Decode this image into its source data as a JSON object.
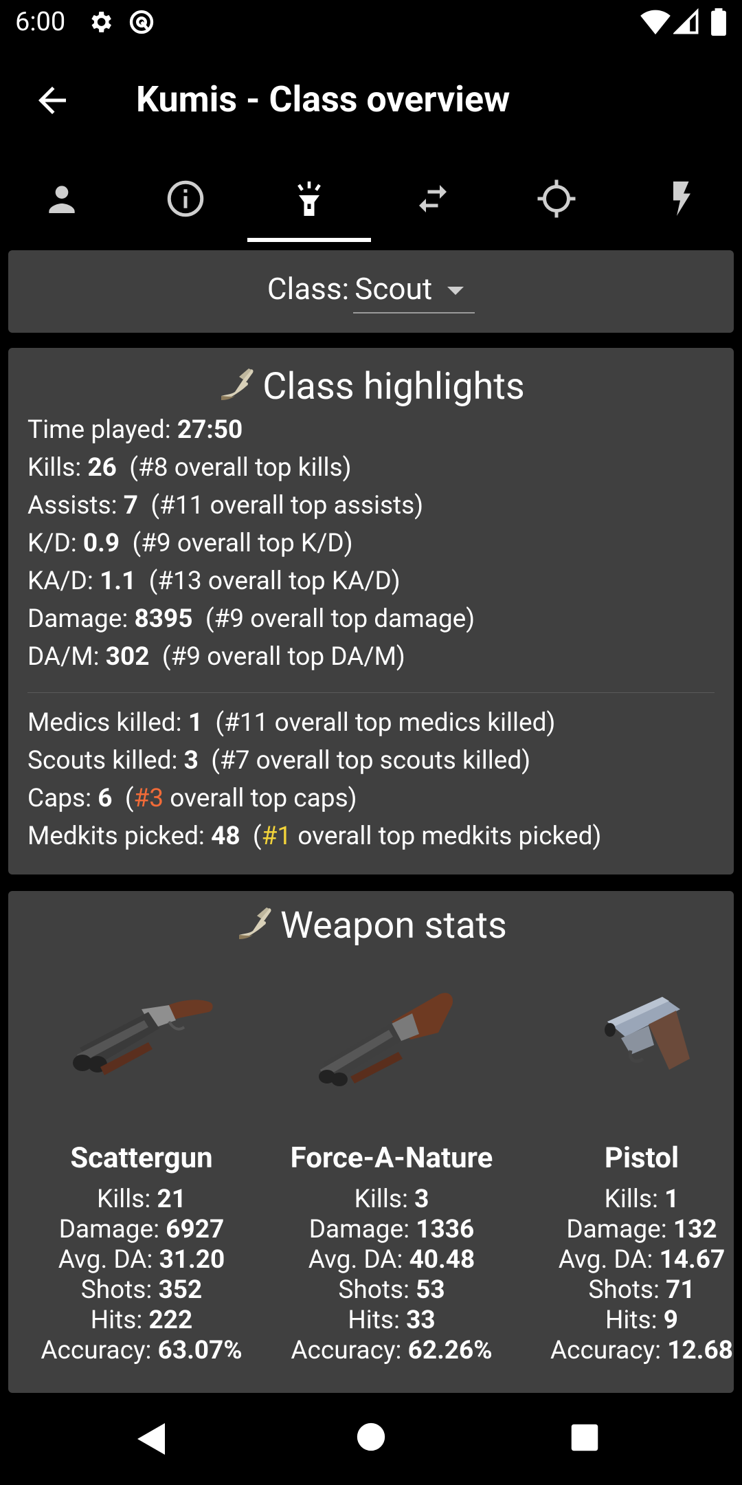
{
  "status_bar": {
    "time": "6:00"
  },
  "app_bar": {
    "title": "Kumis - Class overview"
  },
  "tabs": [
    {
      "name": "profile-tab",
      "icon": "person-icon"
    },
    {
      "name": "info-tab",
      "icon": "info-icon"
    },
    {
      "name": "class-tab",
      "icon": "flashlight-icon",
      "active": true
    },
    {
      "name": "matchups-tab",
      "icon": "swap-icon"
    },
    {
      "name": "crosshair-tab",
      "icon": "crosshair-icon"
    },
    {
      "name": "events-tab",
      "icon": "lightning-icon"
    }
  ],
  "class_selector": {
    "label": "Class:",
    "value": "Scout"
  },
  "highlights": {
    "title": "Class highlights",
    "time_played": {
      "label": "Time played:",
      "value": "27:50"
    },
    "kills": {
      "label": "Kills:",
      "value": "26",
      "rank": "(#8 overall top kills)"
    },
    "assists": {
      "label": "Assists:",
      "value": "7",
      "rank": "(#11 overall top assists)"
    },
    "kd": {
      "label": "K/D:",
      "value": "0.9",
      "rank": "(#9 overall top K/D)"
    },
    "kad": {
      "label": "KA/D:",
      "value": "1.1",
      "rank": "(#13 overall top KA/D)"
    },
    "damage": {
      "label": "Damage:",
      "value": "8395",
      "rank": "(#9 overall top damage)"
    },
    "dam": {
      "label": "DA/M:",
      "value": "302",
      "rank": "(#9 overall top DA/M)"
    },
    "medics_killed": {
      "label": "Medics killed:",
      "value": "1",
      "rank": "(#11 overall top medics killed)"
    },
    "scouts_killed": {
      "label": "Scouts killed:",
      "value": "3",
      "rank": "(#7 overall top scouts killed)"
    },
    "caps": {
      "label": "Caps:",
      "value": "6",
      "rank_open": "(",
      "rank_num": "#3",
      "rank_rest": " overall top caps)",
      "rank_color": "#f26b38"
    },
    "medkits": {
      "label": "Medkits picked:",
      "value": "48",
      "rank_open": "(",
      "rank_num": "#1",
      "rank_rest": " overall top medkits picked)",
      "rank_color": "#f2d33a"
    }
  },
  "weapon_stats": {
    "title": "Weapon stats",
    "labels": {
      "kills": "Kills:",
      "damage": "Damage:",
      "avg_da": "Avg. DA:",
      "shots": "Shots:",
      "hits": "Hits:",
      "accuracy": "Accuracy:"
    },
    "weapons": [
      {
        "name": "Scattergun",
        "kills": "21",
        "damage": "6927",
        "avg_da": "31.20",
        "shots": "352",
        "hits": "222",
        "accuracy": "63.07%"
      },
      {
        "name": "Force-A-Nature",
        "kills": "3",
        "damage": "1336",
        "avg_da": "40.48",
        "shots": "53",
        "hits": "33",
        "accuracy": "62.26%"
      },
      {
        "name": "Pistol",
        "kills": "1",
        "damage": "132",
        "avg_da": "14.67",
        "shots": "71",
        "hits": "9",
        "accuracy": "12.68"
      }
    ]
  },
  "colors": {
    "background": "#000000",
    "card": "#404040",
    "accent_orange": "#f26b38",
    "accent_yellow": "#f2d33a"
  }
}
